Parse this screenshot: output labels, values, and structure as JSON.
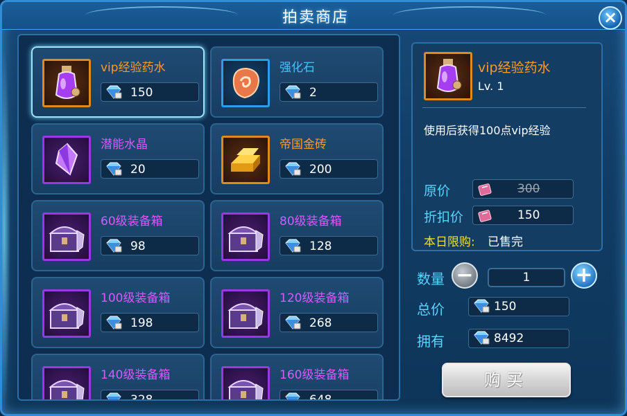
{
  "window": {
    "title": "拍卖商店"
  },
  "items": [
    {
      "name": "vip经验药水",
      "price": "150",
      "icon": "potion-icon",
      "rarity": "orange"
    },
    {
      "name": "强化石",
      "price": "2",
      "icon": "stone-icon",
      "rarity": "blue"
    },
    {
      "name": "潜能水晶",
      "price": "20",
      "icon": "crystal-icon",
      "rarity": "purple"
    },
    {
      "name": "帝国金砖",
      "price": "200",
      "icon": "gold-bar-icon",
      "rarity": "orange"
    },
    {
      "name": "60级装备箱",
      "price": "98",
      "icon": "chest-icon",
      "rarity": "purple"
    },
    {
      "name": "80级装备箱",
      "price": "128",
      "icon": "chest-icon",
      "rarity": "purple"
    },
    {
      "name": "100级装备箱",
      "price": "198",
      "icon": "chest-icon",
      "rarity": "purple"
    },
    {
      "name": "120级装备箱",
      "price": "268",
      "icon": "chest-icon",
      "rarity": "purple"
    },
    {
      "name": "140级装备箱",
      "price": "328",
      "icon": "chest-icon",
      "rarity": "purple"
    },
    {
      "name": "160级装备箱",
      "price": "648",
      "icon": "chest-icon",
      "rarity": "purple"
    }
  ],
  "detail": {
    "name": "vip经验药水",
    "level": "Lv. 1",
    "description": "使用后获得100点vip经验",
    "original_price_label": "原价",
    "original_price": "300",
    "discount_price_label": "折扣价",
    "discount_price": "150",
    "daily_limit_label": "本日限购:",
    "daily_limit_value": "已售完"
  },
  "purchase": {
    "quantity_label": "数量",
    "quantity": "1",
    "total_label": "总价",
    "total": "150",
    "owned_label": "拥有",
    "owned": "8492",
    "buy_label": "购买"
  },
  "colors": {
    "orange": "#ff9a24",
    "blue": "#48c0ff",
    "purple": "#d25cff",
    "label_cyan": "#5ad4ff",
    "limit_yellow": "#f2e02a"
  }
}
